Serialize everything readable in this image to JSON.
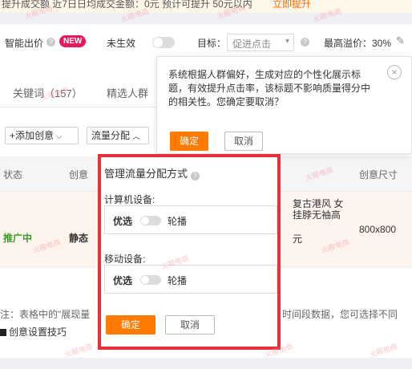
{
  "banner": {
    "text": "提升成交额 近7日日均成交金额：0元  预计可提升 50元以内",
    "link": "立即提升"
  },
  "settings": {
    "smart_bid": "智能出价",
    "new_badge": "NEW",
    "status": "未生效",
    "goal_label": "目标：",
    "goal_value": "促进点击",
    "max_premium_label": "最高溢价：30%"
  },
  "tabs": {
    "keywords": "关键词（157）",
    "crowds": "精选人群"
  },
  "toolbar": {
    "add_creative": "+添加创意",
    "traffic_alloc": "流量分配"
  },
  "table": {
    "headers": [
      "状态",
      "创意",
      "创意尺寸"
    ],
    "row": {
      "status": "推广中",
      "type": "静态",
      "title": "复古港风 女\n挂脖无袖高",
      "price": "元",
      "size": "800x800"
    }
  },
  "note": "注：表格中的\"展现量",
  "note_tail": "时间段数据，您可选择不同",
  "tips": "创意设置技巧",
  "confirm_popover": {
    "message": "系统根据人群偏好，生成对应的个性化展示标题，有效提升点击率，该标题不影响质量得分中的相关性。您确定要取消？",
    "ok": "确定",
    "cancel": "取消"
  },
  "traffic_dialog": {
    "title": "管理流量分配方式",
    "pc_label": "计算机设备:",
    "mobile_label": "移动设备:",
    "preferred": "优选",
    "rotate": "轮播",
    "ok": "确定",
    "cancel": "取消"
  },
  "watermark": "火眼电商",
  "colors": {
    "accent": "#ff7a00",
    "new_badge": "#e8185c",
    "status_green": "#3a9a2a",
    "highlight_border": "#e8303a"
  }
}
